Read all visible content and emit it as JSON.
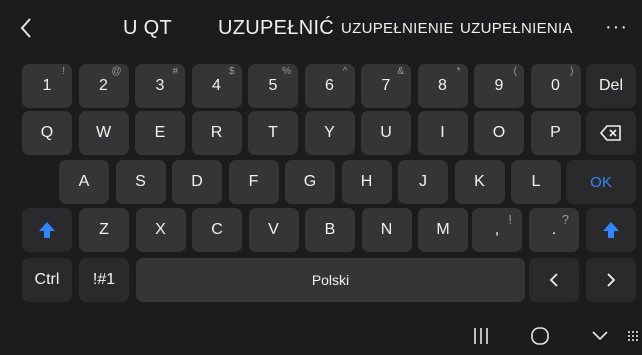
{
  "suggestions": {
    "items": [
      "U QT",
      "UZUPEŁNIĆ",
      "UZUPEŁNIENIE",
      "UZUPEŁNIENIA"
    ],
    "more_label": "···",
    "back_icon": "chevron-left-icon"
  },
  "rows": {
    "numbers": [
      {
        "label": "1",
        "sub": "!"
      },
      {
        "label": "2",
        "sub": "@"
      },
      {
        "label": "3",
        "sub": "#"
      },
      {
        "label": "4",
        "sub": "$"
      },
      {
        "label": "5",
        "sub": "%"
      },
      {
        "label": "6",
        "sub": "^"
      },
      {
        "label": "7",
        "sub": "&"
      },
      {
        "label": "8",
        "sub": "*"
      },
      {
        "label": "9",
        "sub": "("
      },
      {
        "label": "0",
        "sub": ")"
      }
    ],
    "del_label": "Del",
    "row1": [
      "Q",
      "W",
      "E",
      "R",
      "T",
      "Y",
      "U",
      "I",
      "O",
      "P"
    ],
    "row2": [
      "A",
      "S",
      "D",
      "F",
      "G",
      "H",
      "J",
      "K",
      "L"
    ],
    "ok_label": "OK",
    "row3": [
      "Z",
      "X",
      "C",
      "V",
      "B",
      "N",
      "M"
    ],
    "comma": {
      "label": ",",
      "sub": "!"
    },
    "period": {
      "label": ".",
      "sub": "?"
    },
    "ctrl_label": "Ctrl",
    "sym_label": "!#1",
    "space_label": "Polski"
  },
  "colors": {
    "accent": "#2f86ff",
    "key": "#353537",
    "background": "#1c1c1e"
  }
}
